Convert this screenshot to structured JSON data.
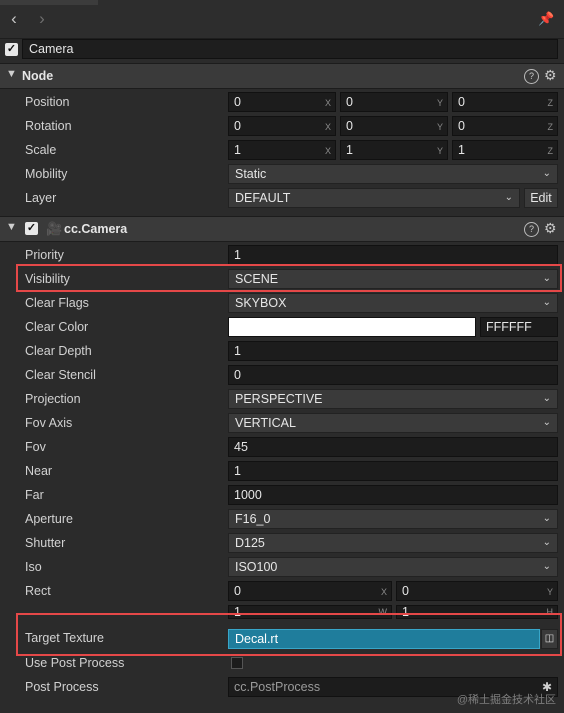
{
  "toolbar": {
    "back_icon": "chevron-left-icon",
    "forward_icon": "chevron-right-icon",
    "pin_icon": "pin-icon"
  },
  "node_name": {
    "checked": true,
    "value": "Camera"
  },
  "node_section": {
    "title": "Node",
    "position": {
      "label": "Position",
      "x": "0",
      "y": "0",
      "z": "0"
    },
    "rotation": {
      "label": "Rotation",
      "x": "0",
      "y": "0",
      "z": "0"
    },
    "scale": {
      "label": "Scale",
      "x": "1",
      "y": "1",
      "z": "1"
    },
    "mobility": {
      "label": "Mobility",
      "value": "Static"
    },
    "layer": {
      "label": "Layer",
      "value": "DEFAULT",
      "edit_label": "Edit"
    },
    "axis_labels": {
      "x": "X",
      "y": "Y",
      "z": "Z"
    }
  },
  "camera_section": {
    "title": "cc.Camera",
    "priority": {
      "label": "Priority",
      "value": "1"
    },
    "visibility": {
      "label": "Visibility",
      "value": "SCENE"
    },
    "clear_flags": {
      "label": "Clear Flags",
      "value": "SKYBOX"
    },
    "clear_color": {
      "label": "Clear Color",
      "hex": "FFFFFF",
      "swatch": "#ffffff"
    },
    "clear_depth": {
      "label": "Clear Depth",
      "value": "1"
    },
    "clear_stencil": {
      "label": "Clear Stencil",
      "value": "0"
    },
    "projection": {
      "label": "Projection",
      "value": "PERSPECTIVE"
    },
    "fov_axis": {
      "label": "Fov Axis",
      "value": "VERTICAL"
    },
    "fov": {
      "label": "Fov",
      "value": "45"
    },
    "near": {
      "label": "Near",
      "value": "1"
    },
    "far": {
      "label": "Far",
      "value": "1000"
    },
    "aperture": {
      "label": "Aperture",
      "value": "F16_0"
    },
    "shutter": {
      "label": "Shutter",
      "value": "D125"
    },
    "iso": {
      "label": "Iso",
      "value": "ISO100"
    },
    "rect": {
      "label": "Rect",
      "x": "0",
      "y": "0",
      "w": "1",
      "h": "1",
      "axis_x": "X",
      "axis_y": "Y",
      "axis_w": "W",
      "axis_h": "H"
    },
    "target_texture": {
      "label": "Target Texture",
      "value": "Decal.rt"
    },
    "use_post_process": {
      "label": "Use Post Process",
      "checked": false
    },
    "post_process": {
      "label": "Post Process",
      "value": "cc.PostProcess"
    }
  },
  "watermark": "@稀土掘金技术社区",
  "colors": {
    "highlight": "#e54848",
    "asset_field": "#1f7d9c"
  }
}
